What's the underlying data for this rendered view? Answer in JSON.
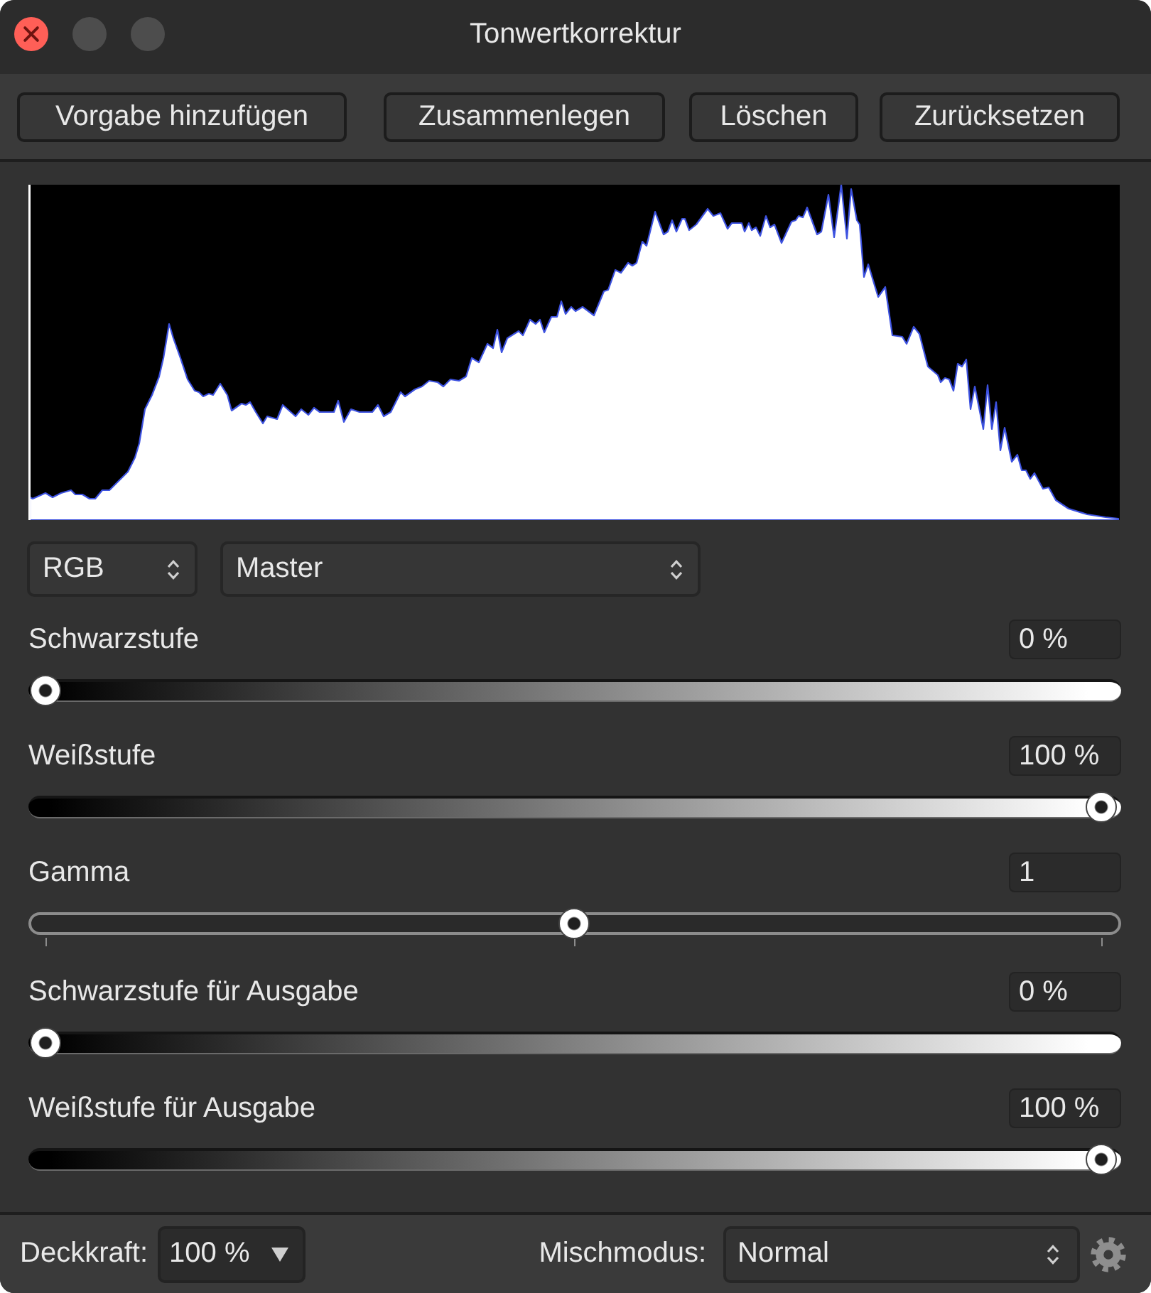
{
  "window": {
    "title": "Tonwertkorrektur",
    "controls": [
      {
        "kind": "close",
        "disabled": false
      },
      {
        "kind": "minimize",
        "disabled": true
      },
      {
        "kind": "zoom",
        "disabled": true
      }
    ]
  },
  "toolbar": {
    "buttons": [
      "Vorgabe hinzufügen",
      "Zusammenlegen",
      "Löschen",
      "Zurücksetzen"
    ]
  },
  "selectors": [
    {
      "value": "RGB"
    },
    {
      "value": "Master"
    }
  ],
  "sliders": [
    {
      "kind": "gradient",
      "label": "Schwarzstufe",
      "value": "0 %",
      "level": 0
    },
    {
      "kind": "gradient",
      "label": "Weißstufe",
      "value": "100 %",
      "level": 1
    },
    {
      "kind": "scale",
      "label": "Gamma",
      "value": "1",
      "level": 0.5
    },
    {
      "kind": "gradient",
      "label": "Schwarzstufe für Ausgabe",
      "value": "0 %",
      "level": 0
    },
    {
      "kind": "gradient",
      "label": "Weißstufe für Ausgabe",
      "value": "100 %",
      "level": 1
    }
  ],
  "footer": {
    "opacity": {
      "label": "Deckkraft:",
      "value": "100 %"
    },
    "blend_mode": {
      "label": "Mischmodus:",
      "value": "Normal"
    }
  }
}
